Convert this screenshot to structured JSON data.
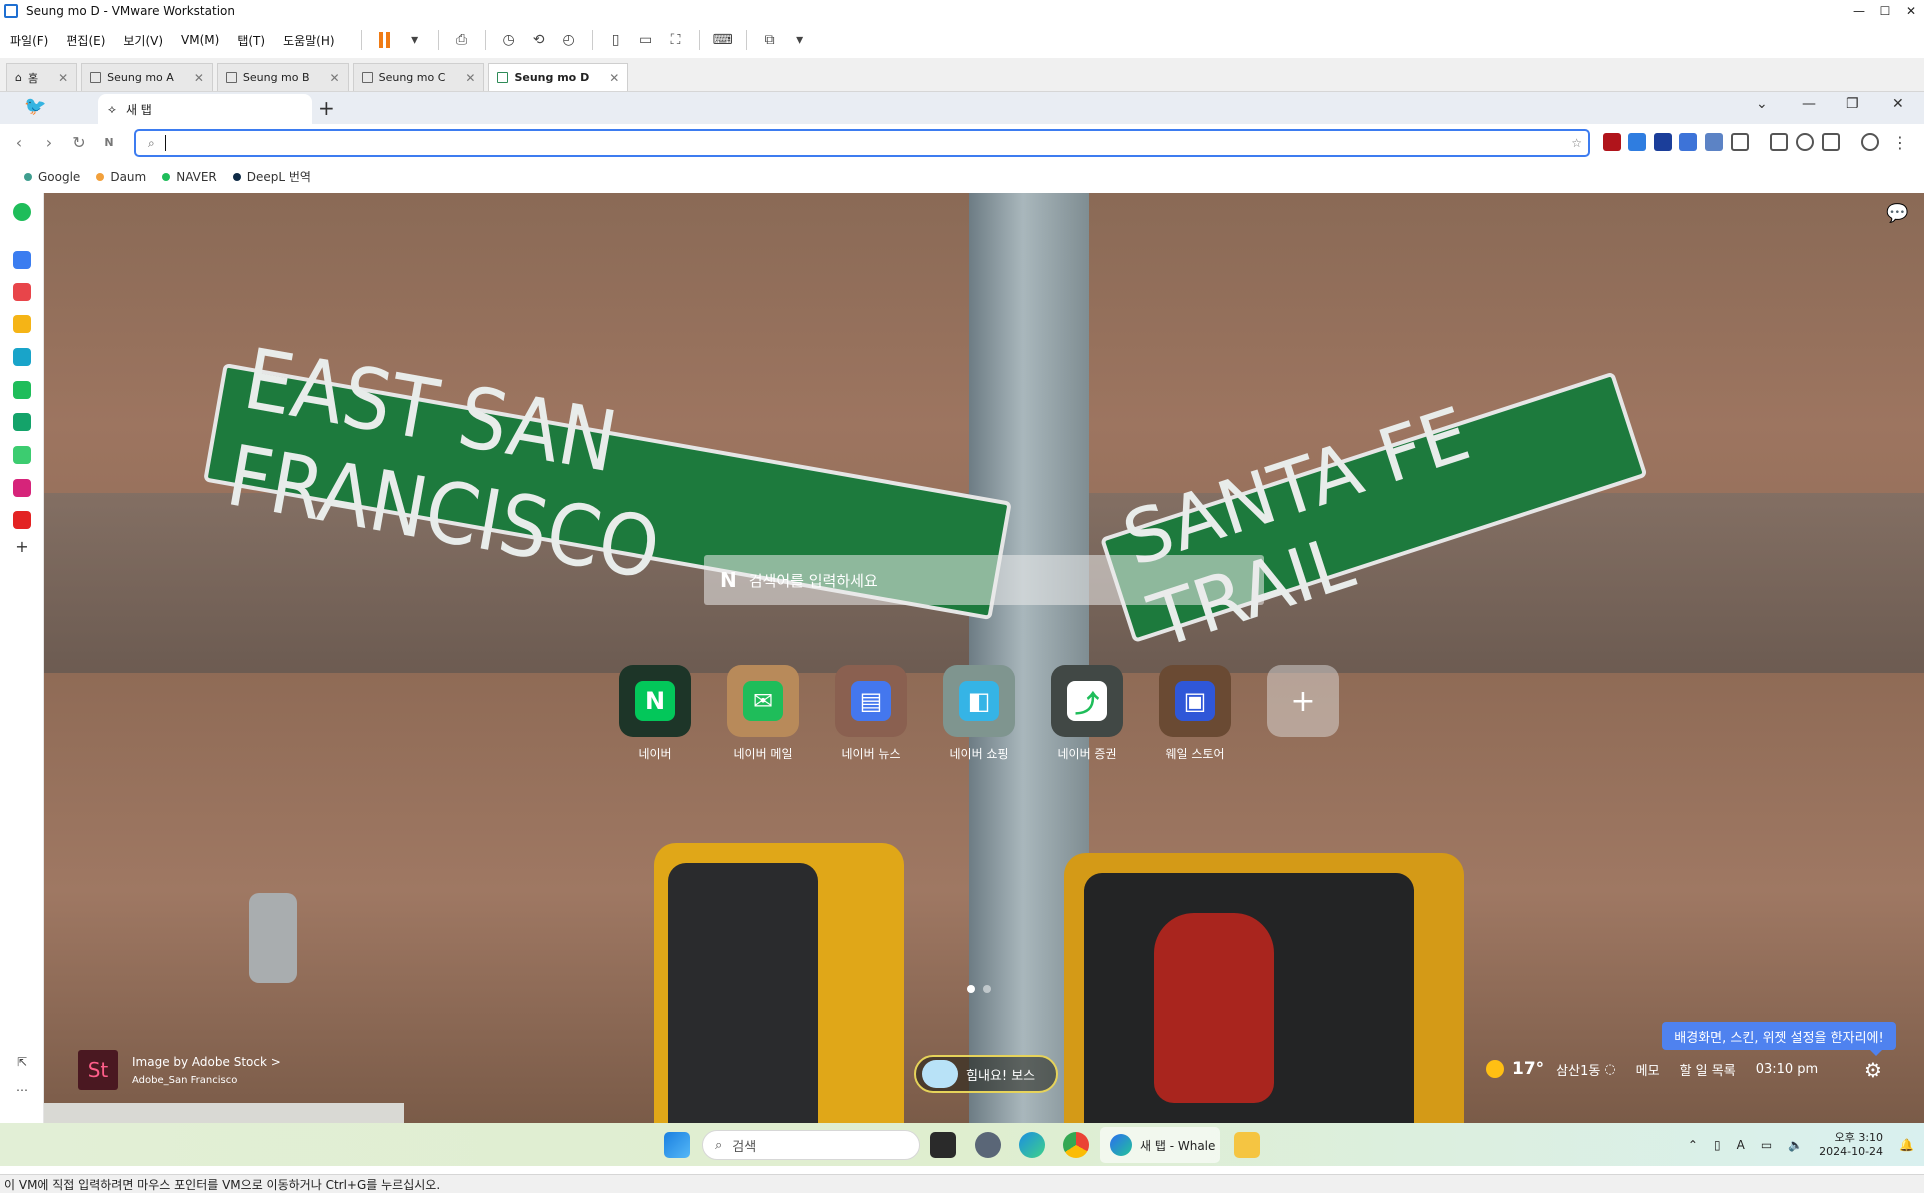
{
  "window": {
    "title": "Seung mo D - VMware Workstation",
    "min": "—",
    "max": "☐",
    "close": "✕"
  },
  "menu": {
    "items": [
      "파일(F)",
      "편집(E)",
      "보기(V)",
      "VM(M)",
      "탭(T)",
      "도움말(H)"
    ]
  },
  "vm_tabs": [
    {
      "label": "홈"
    },
    {
      "label": "Seung mo A"
    },
    {
      "label": "Seung mo B"
    },
    {
      "label": "Seung mo C"
    },
    {
      "label": "Seung mo D",
      "active": true
    }
  ],
  "browser": {
    "tab_title": "새 탭",
    "new_tab": "+",
    "address_value": "",
    "bookmarks": [
      {
        "label": "Google",
        "color": "#3f9e8f"
      },
      {
        "label": "Daum",
        "color": "#f2a03b"
      },
      {
        "label": "NAVER",
        "color": "#1fbd5a"
      },
      {
        "label": "DeepL 번역",
        "color": "#0f2b46"
      }
    ]
  },
  "ntp": {
    "search_placeholder": "검색어를 입력하세요",
    "search_logo": "N",
    "background_sign_left": "EAST SAN FRANCISCO",
    "background_sign_right": "SANTA FE TRAIL",
    "tiles": [
      {
        "label": "네이버",
        "bg": "#1d3528",
        "inner": "#03c75a",
        "glyph": "N"
      },
      {
        "label": "네이버 메일",
        "bg": "#b88a5a",
        "inner": "#1fbd5a",
        "glyph": "✉"
      },
      {
        "label": "네이버 뉴스",
        "bg": "#8a6050",
        "inner": "#4477ee",
        "glyph": "▤"
      },
      {
        "label": "네이버 쇼핑",
        "bg": "#7f958f",
        "inner": "#35b4e6",
        "glyph": "◧"
      },
      {
        "label": "네이버 증권",
        "bg": "#414845",
        "inner": "#ffffff",
        "glyph": "⤴"
      },
      {
        "label": "웨일 스토어",
        "bg": "#6a4a33",
        "inner": "#2f57d8",
        "glyph": "▣"
      },
      {
        "label": "",
        "bg": "rgba(230,230,230,.45)",
        "inner": "transparent",
        "glyph": "+"
      }
    ],
    "credit_title": "Image by Adobe Stock  >",
    "credit_sub": "Adobe_San Francisco",
    "credit_logo": "St",
    "cheer": "힘내요! 보스",
    "tooltip": "배경화면, 스킨, 위젯 설정을 한자리에!",
    "weather_temp": "17°",
    "weather_loc": "삼산1동",
    "memo": "메모",
    "todo": "할 일 목록",
    "time": "03:10 pm"
  },
  "taskbar": {
    "search": "검색",
    "whale_label": "새 탭 - Whale",
    "clock_time": "오후 3:10",
    "clock_date": "2024-10-24"
  },
  "status": "이 VM에 직접 입력하려면 마우스 포인터를 VM으로 이동하거나 Ctrl+G를 누르십시오."
}
